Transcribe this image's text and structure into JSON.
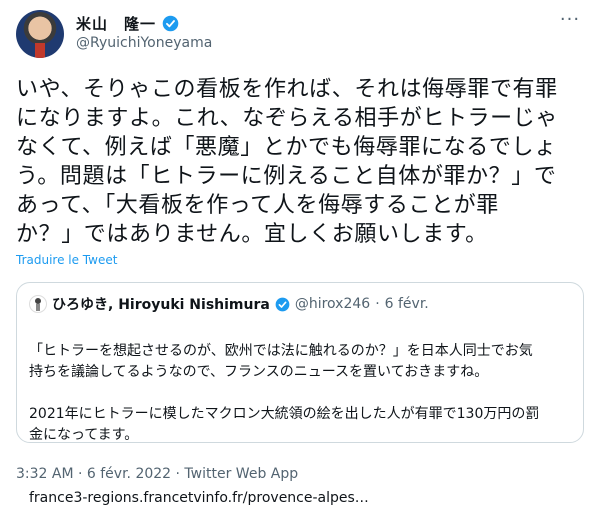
{
  "tweet": {
    "author_name": "米山　隆一",
    "author_handle": "@RyuichiYoneyama",
    "more_icon": "more-icon",
    "text": "いや、そりゃこの看板を作れば、それは侮辱罪で有罪\nになりますよ。これ、なぞらえる相手がヒトラーじゃ\nなくて、例えば「悪魔」とかでも侮辱罪になるでしょ\nう。問題は「ヒトラーに例えること自体が罪か？」で\nあって、「大看板を作って人を侮辱することが罪\nか？」ではありません。宜しくお願いします。",
    "translate_label": "Traduire le Tweet",
    "timestamp": "3:32 AM · 6 févr. 2022 · Twitter Web App"
  },
  "quoted": {
    "author_name": "ひろゆき, Hiroyuki Nishimura",
    "author_handle": "@hirox246",
    "separator": "·",
    "date": "6 févr.",
    "text": "「ヒトラーを想起させるのが、欧州では法に触れるのか？」を日本人同士でお気\n持ちを議論してるようなので、フランスのニュースを置いておきますね。\n\n2021年にヒトラーに模したマクロン大統領の絵を出した人が有罪で130万円の罰\n金になってます。",
    "link": "france3-regions.francetvinfo.fr/provence-alpes…"
  },
  "colors": {
    "verified_blue": "#1d9bf0",
    "secondary_text": "#536471",
    "border": "#cfd9de"
  }
}
